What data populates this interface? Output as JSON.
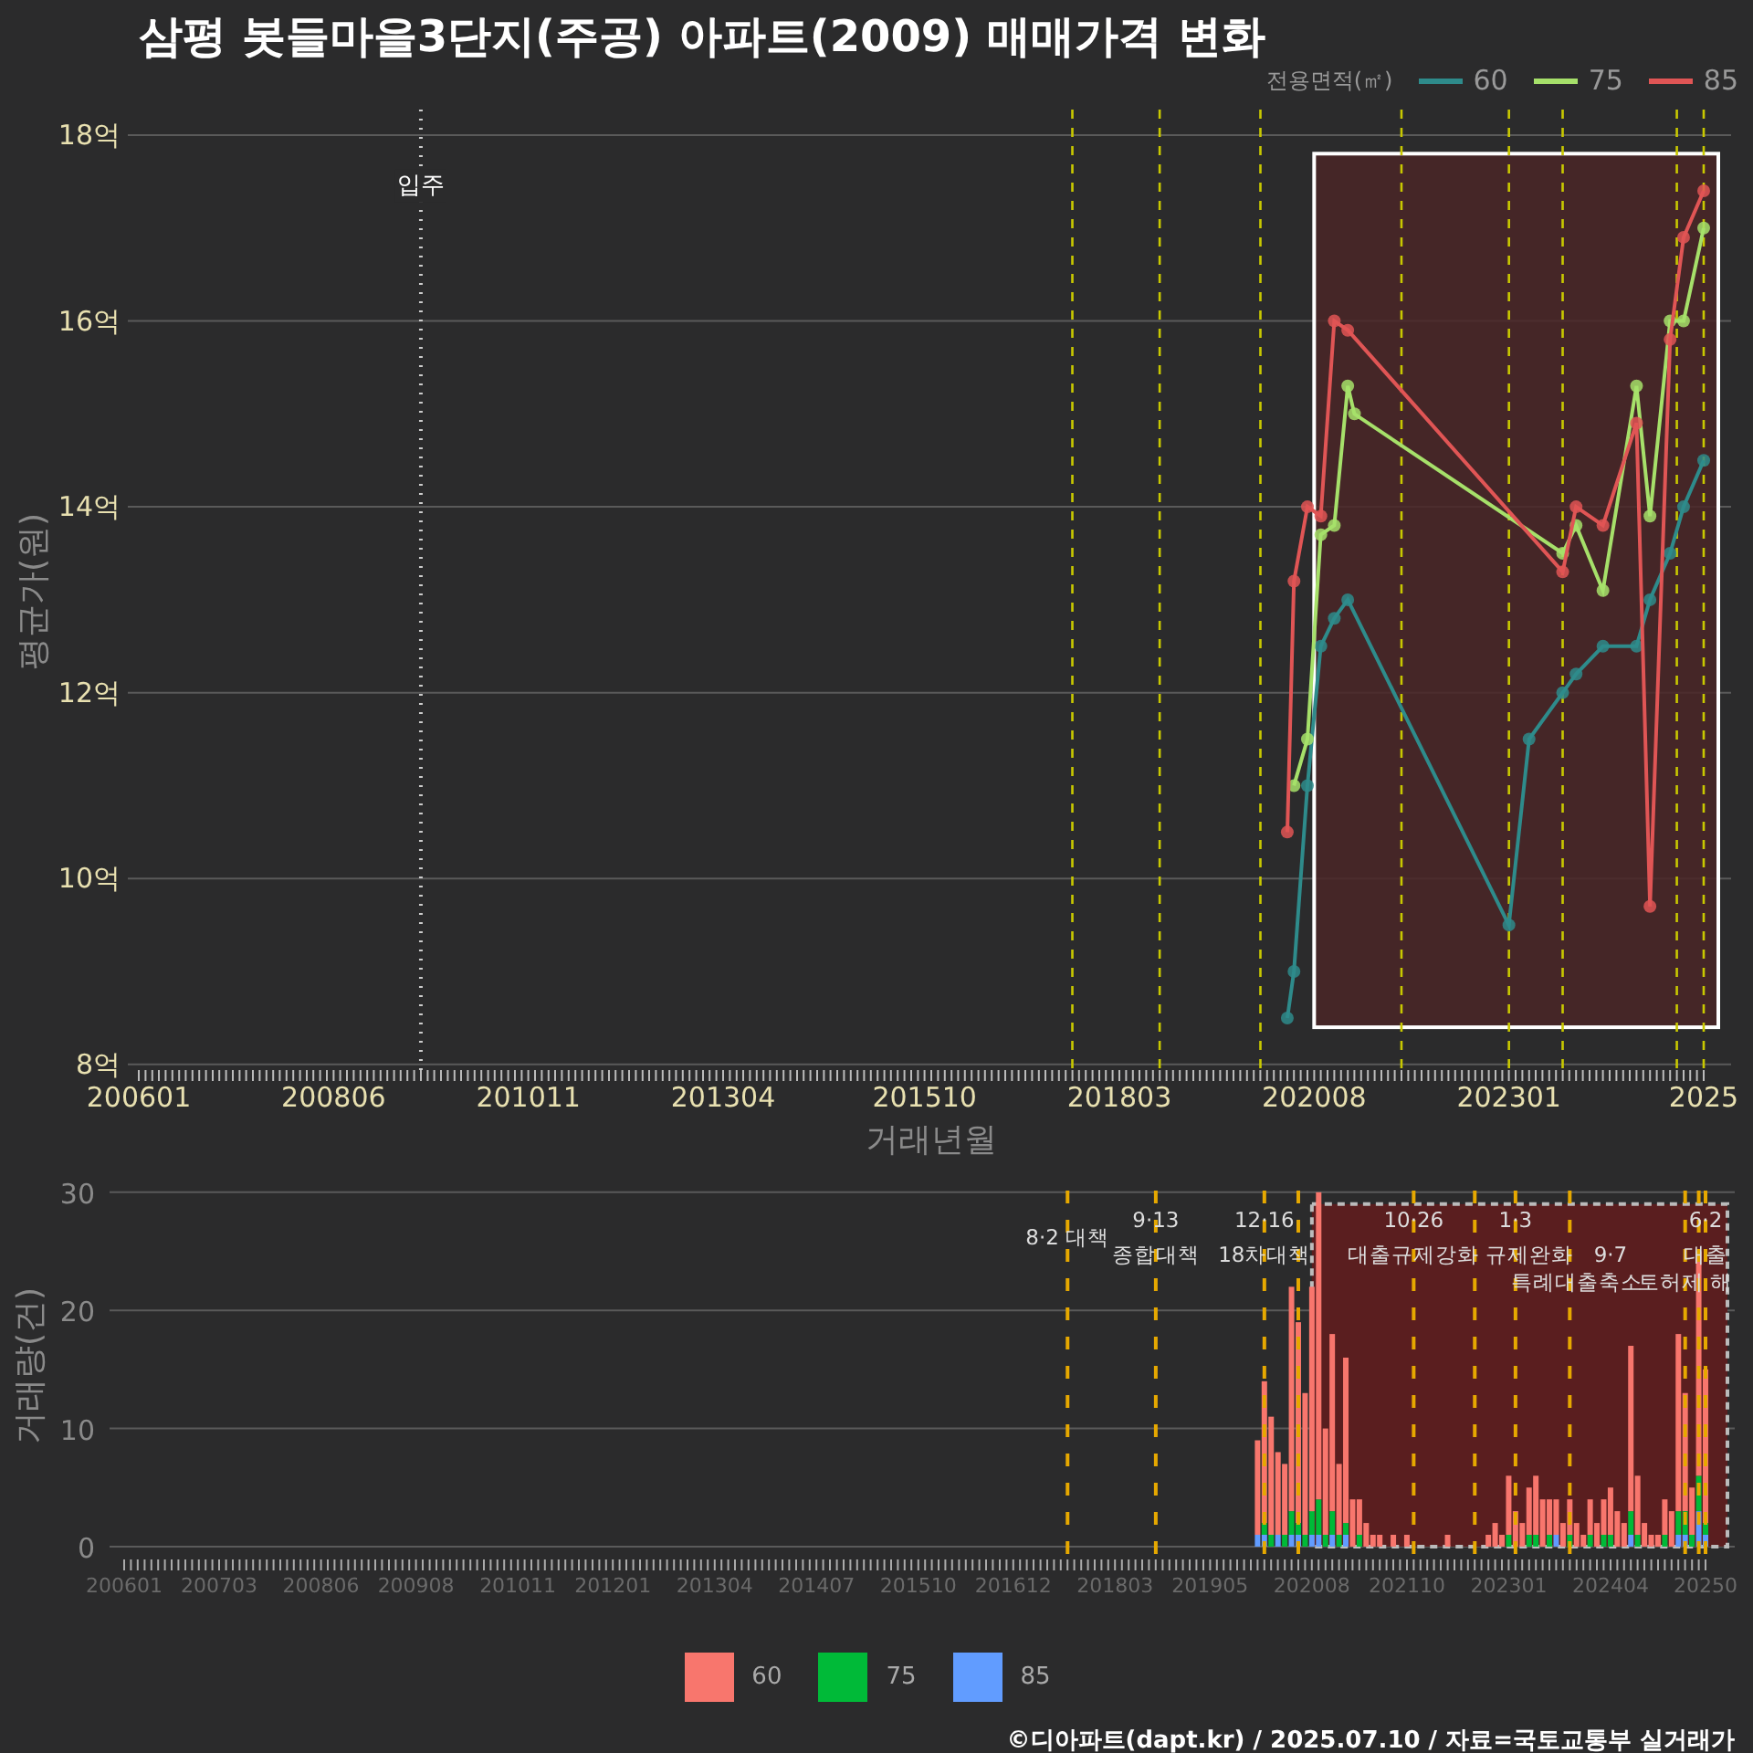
{
  "title": "삼평 봇들마을3단지(주공) 아파트(2009) 매매가격 변화",
  "price_chart": {
    "legend_title": "전용면적(㎡)",
    "chart_data": {
      "type": "line",
      "xlabel": "거래년월",
      "ylabel": "평균가(원)",
      "grid": true,
      "categories": [
        "200601",
        null,
        null,
        null,
        null,
        null,
        null,
        null,
        null,
        null,
        null,
        null,
        null,
        null,
        null,
        null,
        null,
        null,
        null,
        null,
        null,
        null,
        null,
        null,
        null,
        null,
        null,
        null,
        null,
        "200806",
        null,
        null,
        null,
        null,
        null,
        null,
        null,
        null,
        null,
        null,
        null,
        null,
        null,
        null,
        null,
        null,
        null,
        null,
        null,
        null,
        null,
        null,
        null,
        null,
        null,
        null,
        null,
        null,
        "201011",
        null,
        null,
        null,
        null,
        null,
        null,
        null,
        null,
        null,
        null,
        null,
        null,
        null,
        null,
        null,
        null,
        null,
        null,
        null,
        null,
        null,
        null,
        null,
        null,
        null,
        null,
        null,
        null,
        "201304",
        null,
        null,
        null,
        null,
        null,
        null,
        null,
        null,
        null,
        null,
        null,
        null,
        null,
        null,
        null,
        null,
        null,
        null,
        null,
        null,
        null,
        null,
        null,
        null,
        null,
        null,
        null,
        null,
        null,
        "201510",
        null,
        null,
        null,
        null,
        null,
        null,
        null,
        null,
        null,
        null,
        null,
        null,
        null,
        null,
        null,
        null,
        null,
        null,
        null,
        null,
        null,
        null,
        null,
        null,
        null,
        null,
        null,
        null,
        "201803",
        null,
        null,
        null,
        null,
        null,
        null,
        null,
        null,
        null,
        null,
        null,
        null,
        null,
        null,
        null,
        null,
        null,
        null,
        null,
        null,
        null,
        null,
        null,
        null,
        null,
        null,
        null,
        null,
        "202008",
        null,
        null,
        null,
        null,
        null,
        null,
        null,
        null,
        null,
        null,
        null,
        null,
        null,
        null,
        null,
        null,
        null,
        null,
        null,
        null,
        null,
        null,
        null,
        null,
        null,
        null,
        null,
        null,
        "202301",
        null,
        null,
        null,
        null,
        null,
        null,
        null,
        null,
        null,
        null,
        null,
        null,
        null,
        null,
        null,
        null,
        null,
        null,
        null,
        null,
        null,
        null,
        null,
        null,
        null,
        null,
        null,
        null,
        "2025"
      ],
      "series": [
        {
          "name": "60",
          "color": "#2e8b8b",
          "marker": true,
          "values": [
            null,
            null,
            null,
            null,
            null,
            null,
            null,
            null,
            null,
            null,
            null,
            null,
            null,
            null,
            null,
            null,
            null,
            null,
            null,
            null,
            null,
            null,
            null,
            null,
            null,
            null,
            null,
            null,
            null,
            null,
            null,
            null,
            null,
            null,
            null,
            null,
            null,
            null,
            null,
            null,
            null,
            null,
            null,
            null,
            null,
            null,
            null,
            null,
            null,
            null,
            null,
            null,
            null,
            null,
            null,
            null,
            null,
            null,
            null,
            null,
            null,
            null,
            null,
            null,
            null,
            null,
            null,
            null,
            null,
            null,
            null,
            null,
            null,
            null,
            null,
            null,
            null,
            null,
            null,
            null,
            null,
            null,
            null,
            null,
            null,
            null,
            null,
            null,
            null,
            null,
            null,
            null,
            null,
            null,
            null,
            null,
            null,
            null,
            null,
            null,
            null,
            null,
            null,
            null,
            null,
            null,
            null,
            null,
            null,
            null,
            null,
            null,
            null,
            null,
            null,
            null,
            null,
            null,
            null,
            null,
            null,
            null,
            null,
            null,
            null,
            null,
            null,
            null,
            null,
            null,
            null,
            null,
            null,
            null,
            null,
            null,
            null,
            null,
            null,
            null,
            null,
            null,
            null,
            null,
            null,
            null,
            null,
            null,
            null,
            null,
            null,
            null,
            null,
            null,
            null,
            null,
            null,
            null,
            null,
            null,
            null,
            null,
            null,
            null,
            null,
            null,
            null,
            null,
            null,
            null,
            null,
            8.5,
            9.0,
            null,
            11.0,
            null,
            12.5,
            null,
            12.8,
            null,
            13.0,
            null,
            null,
            null,
            null,
            null,
            null,
            null,
            null,
            null,
            null,
            null,
            null,
            null,
            null,
            null,
            null,
            null,
            null,
            null,
            null,
            null,
            null,
            null,
            9.5,
            null,
            null,
            11.5,
            null,
            null,
            null,
            null,
            12.0,
            null,
            12.2,
            null,
            null,
            null,
            12.5,
            null,
            null,
            null,
            null,
            12.5,
            null,
            13.0,
            null,
            null,
            13.5,
            null,
            14.0,
            null,
            null,
            14.5
          ]
        },
        {
          "name": "75",
          "color": "#a6e06a",
          "marker": true,
          "values": [
            null,
            null,
            null,
            null,
            null,
            null,
            null,
            null,
            null,
            null,
            null,
            null,
            null,
            null,
            null,
            null,
            null,
            null,
            null,
            null,
            null,
            null,
            null,
            null,
            null,
            null,
            null,
            null,
            null,
            null,
            null,
            null,
            null,
            null,
            null,
            null,
            null,
            null,
            null,
            null,
            null,
            null,
            null,
            null,
            null,
            null,
            null,
            null,
            null,
            null,
            null,
            null,
            null,
            null,
            null,
            null,
            null,
            null,
            null,
            null,
            null,
            null,
            null,
            null,
            null,
            null,
            null,
            null,
            null,
            null,
            null,
            null,
            null,
            null,
            null,
            null,
            null,
            null,
            null,
            null,
            null,
            null,
            null,
            null,
            null,
            null,
            null,
            null,
            null,
            null,
            null,
            null,
            null,
            null,
            null,
            null,
            null,
            null,
            null,
            null,
            null,
            null,
            null,
            null,
            null,
            null,
            null,
            null,
            null,
            null,
            null,
            null,
            null,
            null,
            null,
            null,
            null,
            null,
            null,
            null,
            null,
            null,
            null,
            null,
            null,
            null,
            null,
            null,
            null,
            null,
            null,
            null,
            null,
            null,
            null,
            null,
            null,
            null,
            null,
            null,
            null,
            null,
            null,
            null,
            null,
            null,
            null,
            null,
            null,
            null,
            null,
            null,
            null,
            null,
            null,
            null,
            null,
            null,
            null,
            null,
            null,
            null,
            null,
            null,
            null,
            null,
            null,
            null,
            null,
            null,
            null,
            null,
            11.0,
            null,
            11.5,
            null,
            13.7,
            null,
            13.8,
            null,
            15.3,
            15.0,
            null,
            null,
            null,
            null,
            null,
            null,
            null,
            null,
            null,
            null,
            null,
            null,
            null,
            null,
            null,
            null,
            null,
            null,
            null,
            null,
            null,
            null,
            null,
            null,
            null,
            null,
            null,
            null,
            null,
            null,
            13.5,
            null,
            13.8,
            null,
            null,
            null,
            13.1,
            null,
            null,
            null,
            null,
            15.3,
            null,
            13.9,
            null,
            null,
            16.0,
            null,
            16.0,
            null,
            null,
            17.0
          ]
        },
        {
          "name": "85",
          "color": "#e05555",
          "marker": true,
          "values": [
            null,
            null,
            null,
            null,
            null,
            null,
            null,
            null,
            null,
            null,
            null,
            null,
            null,
            null,
            null,
            null,
            null,
            null,
            null,
            null,
            null,
            null,
            null,
            null,
            null,
            null,
            null,
            null,
            null,
            null,
            null,
            null,
            null,
            null,
            null,
            null,
            null,
            null,
            null,
            null,
            null,
            null,
            null,
            null,
            null,
            null,
            null,
            null,
            null,
            null,
            null,
            null,
            null,
            null,
            null,
            null,
            null,
            null,
            null,
            null,
            null,
            null,
            null,
            null,
            null,
            null,
            null,
            null,
            null,
            null,
            null,
            null,
            null,
            null,
            null,
            null,
            null,
            null,
            null,
            null,
            null,
            null,
            null,
            null,
            null,
            null,
            null,
            null,
            null,
            null,
            null,
            null,
            null,
            null,
            null,
            null,
            null,
            null,
            null,
            null,
            null,
            null,
            null,
            null,
            null,
            null,
            null,
            null,
            null,
            null,
            null,
            null,
            null,
            null,
            null,
            null,
            null,
            null,
            null,
            null,
            null,
            null,
            null,
            null,
            null,
            null,
            null,
            null,
            null,
            null,
            null,
            null,
            null,
            null,
            null,
            null,
            null,
            null,
            null,
            null,
            null,
            null,
            null,
            null,
            null,
            null,
            null,
            null,
            null,
            null,
            null,
            null,
            null,
            null,
            null,
            null,
            null,
            null,
            null,
            null,
            null,
            null,
            null,
            null,
            null,
            null,
            null,
            null,
            null,
            null,
            null,
            10.5,
            13.2,
            null,
            14.0,
            null,
            13.9,
            null,
            16.0,
            null,
            15.9,
            null,
            null,
            null,
            null,
            null,
            null,
            null,
            null,
            null,
            null,
            null,
            null,
            null,
            null,
            null,
            null,
            null,
            null,
            null,
            null,
            null,
            null,
            null,
            null,
            null,
            null,
            null,
            null,
            null,
            null,
            null,
            13.3,
            null,
            14.0,
            null,
            null,
            null,
            13.8,
            null,
            null,
            null,
            null,
            14.9,
            null,
            9.7,
            null,
            null,
            15.8,
            null,
            16.9,
            null,
            null,
            17.4
          ]
        }
      ],
      "ylim": [
        7.9,
        18.3
      ],
      "yticks": [
        {
          "value": 8,
          "label": "8억"
        },
        {
          "value": 10,
          "label": "10억"
        },
        {
          "value": 12,
          "label": "12억"
        },
        {
          "value": 14,
          "label": "14억"
        },
        {
          "value": 16,
          "label": "16억"
        },
        {
          "value": 18,
          "label": "18억"
        }
      ],
      "annotations": [
        "입주"
      ]
    }
  },
  "volume_chart": {
    "chart_data": {
      "type": "bar",
      "stacked": true,
      "ylabel": "거래량(건)",
      "grid": true,
      "categories": [
        "200601",
        null,
        null,
        null,
        null,
        null,
        null,
        null,
        null,
        null,
        null,
        null,
        null,
        null,
        "200703",
        null,
        null,
        null,
        null,
        null,
        null,
        null,
        null,
        null,
        null,
        null,
        null,
        null,
        null,
        "200806",
        null,
        null,
        null,
        null,
        null,
        null,
        null,
        null,
        null,
        null,
        null,
        null,
        null,
        "200908",
        null,
        null,
        null,
        null,
        null,
        null,
        null,
        null,
        null,
        null,
        null,
        null,
        null,
        null,
        "201011",
        null,
        null,
        null,
        null,
        null,
        null,
        null,
        null,
        null,
        null,
        null,
        null,
        null,
        "201201",
        null,
        null,
        null,
        null,
        null,
        null,
        null,
        null,
        null,
        null,
        null,
        null,
        null,
        null,
        "201304",
        null,
        null,
        null,
        null,
        null,
        null,
        null,
        null,
        null,
        null,
        null,
        null,
        null,
        null,
        "201407",
        null,
        null,
        null,
        null,
        null,
        null,
        null,
        null,
        null,
        null,
        null,
        null,
        null,
        null,
        "201510",
        null,
        null,
        null,
        null,
        null,
        null,
        null,
        null,
        null,
        null,
        null,
        null,
        null,
        "201612",
        null,
        null,
        null,
        null,
        null,
        null,
        null,
        null,
        null,
        null,
        null,
        null,
        null,
        null,
        "201803",
        null,
        null,
        null,
        null,
        null,
        null,
        null,
        null,
        null,
        null,
        null,
        null,
        null,
        "201905",
        null,
        null,
        null,
        null,
        null,
        null,
        null,
        null,
        null,
        null,
        null,
        null,
        null,
        null,
        "202008",
        null,
        null,
        null,
        null,
        null,
        null,
        null,
        null,
        null,
        null,
        null,
        null,
        null,
        "202110",
        null,
        null,
        null,
        null,
        null,
        null,
        null,
        null,
        null,
        null,
        null,
        null,
        null,
        null,
        "202301",
        null,
        null,
        null,
        null,
        null,
        null,
        null,
        null,
        null,
        null,
        null,
        null,
        null,
        null,
        "202404",
        null,
        null,
        null,
        null,
        null,
        null,
        null,
        null,
        null,
        null,
        null,
        null,
        null,
        "20250"
      ],
      "series": [
        {
          "name": "60",
          "color": "#f8766d",
          "values": [
            0,
            0,
            0,
            0,
            0,
            0,
            0,
            0,
            0,
            0,
            0,
            0,
            0,
            0,
            0,
            0,
            0,
            0,
            0,
            0,
            0,
            0,
            0,
            0,
            0,
            0,
            0,
            0,
            0,
            0,
            0,
            0,
            0,
            0,
            0,
            0,
            0,
            0,
            0,
            0,
            0,
            0,
            0,
            0,
            0,
            0,
            0,
            0,
            0,
            0,
            0,
            0,
            0,
            0,
            0,
            0,
            0,
            0,
            0,
            0,
            0,
            0,
            0,
            0,
            0,
            0,
            0,
            0,
            0,
            0,
            0,
            0,
            0,
            0,
            0,
            0,
            0,
            0,
            0,
            0,
            0,
            0,
            0,
            0,
            0,
            0,
            0,
            0,
            0,
            0,
            0,
            0,
            0,
            0,
            0,
            0,
            0,
            0,
            0,
            0,
            0,
            0,
            0,
            0,
            0,
            0,
            0,
            0,
            0,
            0,
            0,
            0,
            0,
            0,
            0,
            0,
            0,
            0,
            0,
            0,
            0,
            0,
            0,
            0,
            0,
            0,
            0,
            0,
            0,
            0,
            0,
            0,
            0,
            0,
            0,
            0,
            0,
            0,
            0,
            0,
            0,
            0,
            0,
            0,
            0,
            0,
            0,
            0,
            0,
            0,
            0,
            0,
            0,
            0,
            0,
            0,
            0,
            0,
            0,
            0,
            0,
            0,
            0,
            0,
            0,
            0,
            0,
            8,
            12,
            10,
            7,
            6,
            19,
            17,
            12,
            19,
            26,
            9,
            15,
            6,
            14,
            4,
            3,
            2,
            1,
            1,
            0,
            1,
            0,
            1,
            0,
            0,
            0,
            0,
            0,
            1,
            0,
            0,
            0,
            0,
            0,
            1,
            2,
            1,
            5,
            3,
            2,
            4,
            5,
            4,
            3,
            3,
            2,
            3,
            2,
            1,
            3,
            2,
            3,
            4,
            3,
            2,
            14,
            5,
            2,
            1,
            1,
            3,
            3,
            15,
            10,
            4,
            19,
            13
          ]
        },
        {
          "name": "75",
          "color": "#00ba38",
          "values": [
            0,
            0,
            0,
            0,
            0,
            0,
            0,
            0,
            0,
            0,
            0,
            0,
            0,
            0,
            0,
            0,
            0,
            0,
            0,
            0,
            0,
            0,
            0,
            0,
            0,
            0,
            0,
            0,
            0,
            0,
            0,
            0,
            0,
            0,
            0,
            0,
            0,
            0,
            0,
            0,
            0,
            0,
            0,
            0,
            0,
            0,
            0,
            0,
            0,
            0,
            0,
            0,
            0,
            0,
            0,
            0,
            0,
            0,
            0,
            0,
            0,
            0,
            0,
            0,
            0,
            0,
            0,
            0,
            0,
            0,
            0,
            0,
            0,
            0,
            0,
            0,
            0,
            0,
            0,
            0,
            0,
            0,
            0,
            0,
            0,
            0,
            0,
            0,
            0,
            0,
            0,
            0,
            0,
            0,
            0,
            0,
            0,
            0,
            0,
            0,
            0,
            0,
            0,
            0,
            0,
            0,
            0,
            0,
            0,
            0,
            0,
            0,
            0,
            0,
            0,
            0,
            0,
            0,
            0,
            0,
            0,
            0,
            0,
            0,
            0,
            0,
            0,
            0,
            0,
            0,
            0,
            0,
            0,
            0,
            0,
            0,
            0,
            0,
            0,
            0,
            0,
            0,
            0,
            0,
            0,
            0,
            0,
            0,
            0,
            0,
            0,
            0,
            0,
            0,
            0,
            0,
            0,
            0,
            0,
            0,
            0,
            0,
            0,
            0,
            0,
            0,
            0,
            0,
            1,
            1,
            0,
            1,
            2,
            1,
            1,
            2,
            3,
            1,
            2,
            1,
            1,
            0,
            1,
            0,
            0,
            0,
            0,
            0,
            0,
            0,
            0,
            0,
            0,
            0,
            0,
            0,
            0,
            0,
            0,
            0,
            0,
            0,
            0,
            0,
            1,
            0,
            0,
            1,
            1,
            0,
            1,
            0,
            0,
            1,
            0,
            0,
            1,
            0,
            1,
            1,
            0,
            0,
            2,
            1,
            0,
            0,
            0,
            1,
            0,
            2,
            2,
            1,
            3,
            1
          ]
        },
        {
          "name": "85",
          "color": "#619cff",
          "values": [
            0,
            0,
            0,
            0,
            0,
            0,
            0,
            0,
            0,
            0,
            0,
            0,
            0,
            0,
            0,
            0,
            0,
            0,
            0,
            0,
            0,
            0,
            0,
            0,
            0,
            0,
            0,
            0,
            0,
            0,
            0,
            0,
            0,
            0,
            0,
            0,
            0,
            0,
            0,
            0,
            0,
            0,
            0,
            0,
            0,
            0,
            0,
            0,
            0,
            0,
            0,
            0,
            0,
            0,
            0,
            0,
            0,
            0,
            0,
            0,
            0,
            0,
            0,
            0,
            0,
            0,
            0,
            0,
            0,
            0,
            0,
            0,
            0,
            0,
            0,
            0,
            0,
            0,
            0,
            0,
            0,
            0,
            0,
            0,
            0,
            0,
            0,
            0,
            0,
            0,
            0,
            0,
            0,
            0,
            0,
            0,
            0,
            0,
            0,
            0,
            0,
            0,
            0,
            0,
            0,
            0,
            0,
            0,
            0,
            0,
            0,
            0,
            0,
            0,
            0,
            0,
            0,
            0,
            0,
            0,
            0,
            0,
            0,
            0,
            0,
            0,
            0,
            0,
            0,
            0,
            0,
            0,
            0,
            0,
            0,
            0,
            0,
            0,
            0,
            0,
            0,
            0,
            0,
            0,
            0,
            0,
            0,
            0,
            0,
            0,
            0,
            0,
            0,
            0,
            0,
            0,
            0,
            0,
            0,
            0,
            0,
            0,
            0,
            0,
            0,
            0,
            0,
            1,
            1,
            0,
            1,
            0,
            1,
            1,
            0,
            1,
            1,
            0,
            1,
            0,
            1,
            0,
            0,
            0,
            0,
            0,
            0,
            0,
            0,
            0,
            0,
            0,
            0,
            0,
            0,
            0,
            0,
            0,
            0,
            0,
            0,
            0,
            0,
            0,
            0,
            0,
            0,
            0,
            0,
            0,
            0,
            1,
            0,
            0,
            0,
            0,
            0,
            0,
            0,
            0,
            0,
            0,
            1,
            0,
            0,
            0,
            0,
            0,
            0,
            1,
            1,
            0,
            3,
            1
          ]
        }
      ],
      "ylim": [
        -0.5,
        30.5
      ],
      "yticks": [
        0,
        10,
        20,
        30
      ],
      "annotations": [
        "8·2 대책",
        "9·13",
        "종합대책",
        "12·16",
        "18차대책",
        "10·26",
        "대출규제강화",
        "1·3",
        "규제완화",
        "9·7",
        "특례대출축소",
        "토허제 해",
        "6·2",
        "대출"
      ]
    }
  },
  "footer": "©디아파트(dapt.kr) / 2025.07.10 / 자료=국토교통부 실거래가"
}
